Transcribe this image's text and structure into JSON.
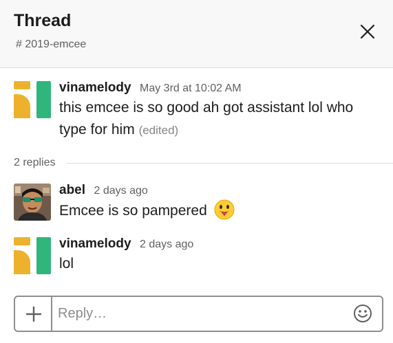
{
  "header": {
    "title": "Thread",
    "channel": "# 2019-emcee"
  },
  "thread": {
    "parent": {
      "author": "vinamelody",
      "timestamp": "May 3rd at 10:02 AM",
      "text": "this emcee is so good ah got assistant lol who type for him",
      "edited_label": "(edited)"
    },
    "reply_count": "2 replies",
    "replies": [
      {
        "author": "abel",
        "timestamp": "2 days ago",
        "text": "Emcee is so pampered",
        "emoji": "stuck-out-tongue-emoji"
      },
      {
        "author": "vinamelody",
        "timestamp": "2 days ago",
        "text": "lol"
      }
    ]
  },
  "composer": {
    "placeholder": "Reply…"
  },
  "colors": {
    "avatar_yellow": "#ecb22e",
    "avatar_green": "#2eb67d",
    "header_bg": "#f8f8f8"
  },
  "icons": {
    "close": "close-icon",
    "attach": "plus-icon",
    "emoji_picker": "emoji-icon"
  }
}
